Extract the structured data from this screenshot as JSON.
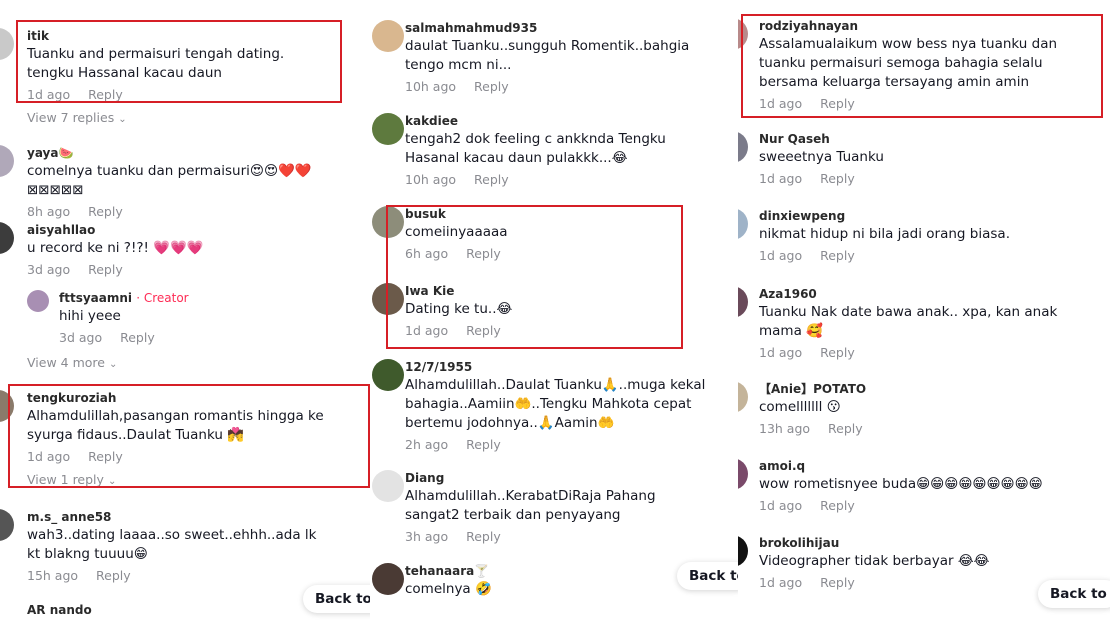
{
  "panels": [
    {
      "comments": [
        {
          "username": "itik",
          "text": "Tuanku and permaisuri tengah dating. tengku Hassanal kacau daun",
          "time": "1d ago",
          "reply": "Reply"
        },
        {
          "username": "yaya🍉",
          "text": "comelnya tuanku dan permaisuri😍😍❤️❤️⊠⊠⊠⊠⊠",
          "time": "8h ago",
          "reply": "Reply"
        },
        {
          "username": "aisyahllao",
          "text": "u record ke ni ?!?! 💗💗💗",
          "time": "3d ago",
          "reply": "Reply"
        },
        {
          "username": "fttsyaamni",
          "creator_tag": "· Creator",
          "text": "hihi yeee",
          "time": "3d ago",
          "reply": "Reply"
        },
        {
          "username": "tengkuroziah",
          "text": "Alhamdulillah,pasangan romantis hingga ke syurga fidaus..Daulat Tuanku 💏",
          "time": "1d ago",
          "reply": "Reply"
        },
        {
          "username": "m.s_ anne58",
          "text": "wah3..dating laaaa..so sweet..ehhh..ada lk kt blakng tuuuu😁",
          "time": "15h ago",
          "reply": "Reply"
        },
        {
          "username": "AR nando",
          "text": "",
          "time": "",
          "reply": ""
        }
      ],
      "view_links": [
        "View 7 replies",
        "View 4 more",
        "View 1 reply"
      ],
      "back_to_top": "Back to t"
    },
    {
      "comments": [
        {
          "username": "salmahmahmud935",
          "text": "daulat Tuanku..sungguh Romentik..bahgia tengo mcm ni...",
          "time": "10h ago",
          "reply": "Reply"
        },
        {
          "username": "kakdiee",
          "text": "tengah2 dok feeling c ankknda Tengku Hasanal kacau daun pulakkk...😂",
          "time": "10h ago",
          "reply": "Reply"
        },
        {
          "username": "busuk",
          "text": "comeiinyaaaaa",
          "time": "6h ago",
          "reply": "Reply"
        },
        {
          "username": "Iwa Kie",
          "text": "Dating ke tu..😂",
          "time": "1d ago",
          "reply": "Reply"
        },
        {
          "username": "12/7/1955",
          "text": "Alhamdulillah..Daulat Tuanku🙏..muga kekal bahagia..Aamiin🤲..Tengku Mahkota cepat bertemu jodohnya..🙏Aamin🤲",
          "time": "2h ago",
          "reply": "Reply"
        },
        {
          "username": "Diang",
          "text": "Alhamdulillah..KerabatDiRaja Pahang sangat2 terbaik dan penyayang",
          "time": "3h ago",
          "reply": "Reply"
        },
        {
          "username": "tehanaara🍸",
          "text": "comelnya 🤣",
          "time": "",
          "reply": ""
        }
      ],
      "back_to_top": "Back to"
    },
    {
      "comments": [
        {
          "username": "rodziyahnayan",
          "text": "Assalamualaikum wow bess nya tuanku dan tuanku permaisuri semoga bahagia selalu bersama keluarga tersayang amin amin",
          "time": "1d ago",
          "reply": "Reply"
        },
        {
          "username": "Nur Qaseh",
          "text": "sweeetnya Tuanku",
          "time": "1d ago",
          "reply": "Reply"
        },
        {
          "username": "dinxiewpeng",
          "text": "nikmat hidup ni bila jadi orang biasa.",
          "time": "1d ago",
          "reply": "Reply"
        },
        {
          "username": "Aza1960",
          "text": "Tuanku Nak date bawa anak.. xpa, kan anak mama 🥰",
          "time": "1d ago",
          "reply": "Reply"
        },
        {
          "username": "【Anie】POTATO",
          "text": "comelllllll 😗",
          "time": "13h ago",
          "reply": "Reply"
        },
        {
          "username": "amoi.q",
          "text": "wow rometisnyee buda😁😁😁😁😁😁😁😁😁",
          "time": "1d ago",
          "reply": "Reply"
        },
        {
          "username": "brokolihijau",
          "text": "Videographer tidak berbayar 😂😂",
          "time": "1d ago",
          "reply": "Reply"
        }
      ],
      "back_to_top": "Back to"
    }
  ],
  "colors": {
    "highlight": "#d61f26",
    "meta_text": "#8a8b91",
    "creator": "#fe2c55"
  }
}
